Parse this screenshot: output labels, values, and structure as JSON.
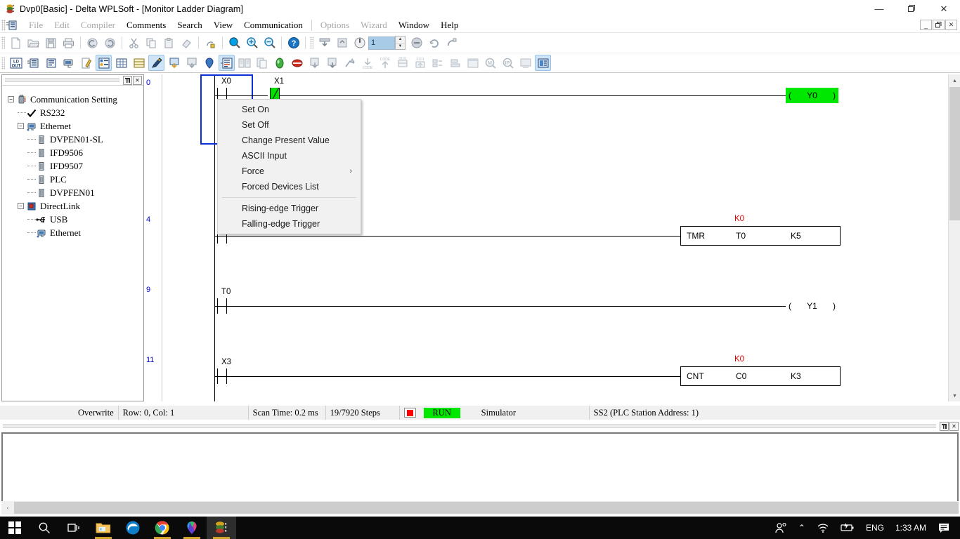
{
  "window": {
    "title": "Dvp0[Basic] - Delta WPLSoft - [Monitor Ladder Diagram]",
    "app_icon": "wplsoft-icon",
    "minimize": "—",
    "maximize": "❐",
    "close": "✕",
    "mdi_minimize": "_",
    "mdi_restore": "❐",
    "mdi_close": "✕"
  },
  "menubar": {
    "items": [
      {
        "label": "File",
        "disabled": true
      },
      {
        "label": "Edit",
        "disabled": true
      },
      {
        "label": "Compiler",
        "disabled": true
      },
      {
        "label": "Comments",
        "disabled": false
      },
      {
        "label": "Search",
        "disabled": false
      },
      {
        "label": "View",
        "disabled": false
      },
      {
        "label": "Communication",
        "disabled": false
      },
      {
        "label": "Options",
        "disabled": true
      },
      {
        "label": "Wizard",
        "disabled": true
      },
      {
        "label": "Window",
        "disabled": false
      },
      {
        "label": "Help",
        "disabled": false
      }
    ]
  },
  "toolbar_main": {
    "spin_value": "1",
    "buttons": [
      "new-file-icon",
      "open-file-icon",
      "save-icon",
      "print-icon",
      "undo-icon",
      "redo-icon",
      "cut-icon",
      "copy-icon",
      "paste-icon",
      "erase-icon",
      "ladder-instruction-toggle-icon",
      "zoom-icon",
      "zoom-in-icon",
      "zoom-out-icon",
      "help-icon",
      "download-plc-icon",
      "upload-plc-icon",
      "run-stop-icon",
      "plc-station-stepper",
      "stop-plc-icon",
      "monitor-refresh-icon",
      "program-monitor-icon"
    ]
  },
  "toolbar_ladder": {
    "buttons": [
      "ld-out-icon",
      "ladder-view-icon",
      "instruction-view-icon",
      "device-monitor-icon",
      "comment-edit-icon",
      "contact-list-icon",
      "grid-icon",
      "register-table-icon",
      "highlight-pen-icon",
      "insert-row-icon",
      "delete-row-icon",
      "balloon-comment-icon",
      "monitor-mode-icon",
      "compare-icon",
      "copy-program-icon",
      "run-green-icon",
      "stop-red-icon",
      "write-plc-icon",
      "read-plc-icon",
      "disconnect-icon",
      "code-down-icon",
      "code-up-icon",
      "code-table-icon",
      "bit-table-icon",
      "sort-icon",
      "align-icon",
      "window-icon",
      "find-device-icon",
      "find-instruction-icon",
      "save-image-icon",
      "simulator-icon"
    ],
    "active": [
      "contact-list-icon",
      "highlight-pen-icon",
      "monitor-mode-icon",
      "simulator-icon"
    ]
  },
  "left_dock": {
    "pin_label": "➤",
    "close_label": "✕",
    "tree": [
      {
        "label": "Communication Setting",
        "icon": "comm-setting-icon",
        "level": 0,
        "expander": "-"
      },
      {
        "label": "RS232",
        "icon": "check-icon",
        "level": 1,
        "expander": ""
      },
      {
        "label": "Ethernet",
        "icon": "ethernet-icon",
        "level": 1,
        "expander": "-"
      },
      {
        "label": "DVPEN01-SL",
        "icon": "module-icon",
        "level": 2,
        "expander": ""
      },
      {
        "label": "IFD9506",
        "icon": "module-icon",
        "level": 2,
        "expander": ""
      },
      {
        "label": "IFD9507",
        "icon": "module-icon",
        "level": 2,
        "expander": ""
      },
      {
        "label": "PLC",
        "icon": "module-icon",
        "level": 2,
        "expander": ""
      },
      {
        "label": "DVPFEN01",
        "icon": "module-icon",
        "level": 2,
        "expander": ""
      },
      {
        "label": "DirectLink",
        "icon": "directlink-icon",
        "level": 1,
        "expander": "-"
      },
      {
        "label": "USB",
        "icon": "usb-icon",
        "level": 2,
        "expander": ""
      },
      {
        "label": "Ethernet",
        "icon": "ethernet-icon",
        "level": 2,
        "expander": ""
      }
    ]
  },
  "ladder": {
    "rung_numbers": [
      "0",
      "4",
      "9",
      "11"
    ],
    "rungs": [
      {
        "number": "0",
        "contacts": [
          {
            "device": "X0",
            "type": "NO",
            "state": "off",
            "selected": true
          },
          {
            "device": "X1",
            "type": "NC",
            "state": "on",
            "selected": false
          }
        ],
        "coil": {
          "device": "Y0",
          "state": "on"
        }
      },
      {
        "number": "4",
        "contacts": [
          {
            "device": "",
            "type": "NO",
            "state": "off",
            "selected": false
          }
        ],
        "instruction": {
          "name": "TMR",
          "operand1": "T0",
          "operand2": "K5",
          "present_value": "K0"
        }
      },
      {
        "number": "9",
        "contacts": [
          {
            "device": "T0",
            "type": "NO",
            "state": "off",
            "selected": false
          }
        ],
        "coil": {
          "device": "Y1",
          "state": "off"
        }
      },
      {
        "number": "11",
        "contacts": [
          {
            "device": "X3",
            "type": "NO",
            "state": "off",
            "selected": false
          }
        ],
        "instruction": {
          "name": "CNT",
          "operand1": "C0",
          "operand2": "K3",
          "present_value": "K0"
        }
      }
    ]
  },
  "context_menu": {
    "items": [
      {
        "label": "Set On",
        "submenu": false
      },
      {
        "label": "Set Off",
        "submenu": false
      },
      {
        "label": "Change Present Value",
        "submenu": false
      },
      {
        "label": "ASCII Input",
        "submenu": false
      },
      {
        "label": "Force",
        "submenu": true,
        "arrow": "›"
      },
      {
        "label": "Forced Devices List",
        "submenu": false
      },
      {
        "separator": true
      },
      {
        "label": "Rising-edge Trigger",
        "submenu": false
      },
      {
        "label": "Falling-edge Trigger",
        "submenu": false
      }
    ]
  },
  "statusbar": {
    "mode": "Overwrite",
    "position": "Row: 0, Col: 1",
    "scan_time": "Scan Time: 0.2 ms",
    "steps": "19/7920 Steps",
    "run_label": "RUN",
    "connection": "Simulator",
    "plc_model": "SS2 (PLC Station Address: 1)"
  },
  "output_pane": {
    "content": "",
    "scroll_left": "‹"
  },
  "taskbar": {
    "items": [
      {
        "name": "start-button",
        "icon": "windows-logo-icon",
        "active": false
      },
      {
        "name": "search-button",
        "icon": "search-icon",
        "active": false
      },
      {
        "name": "task-view-button",
        "icon": "task-view-icon",
        "active": false
      },
      {
        "name": "file-explorer",
        "icon": "folder-icon",
        "active": false,
        "running": true
      },
      {
        "name": "microsoft-edge",
        "icon": "edge-icon",
        "active": false,
        "running": false
      },
      {
        "name": "google-chrome",
        "icon": "chrome-icon",
        "active": false,
        "running": true
      },
      {
        "name": "maps-app",
        "icon": "maps-pin-icon",
        "active": false,
        "running": true
      },
      {
        "name": "wplsoft-app",
        "icon": "wplsoft-icon",
        "active": true,
        "running": true
      }
    ],
    "tray": {
      "people_icon": "people-icon",
      "chevron_icon": "⌃",
      "network_icon": "wifi-icon",
      "battery_icon": "battery-icon",
      "language": "ENG",
      "time": "1:33 AM",
      "notifications_icon": "notification-icon"
    }
  },
  "colors": {
    "energized_green": "#00e800",
    "present_value_red": "#e00000",
    "rung_number_blue": "#0000cc",
    "selection_blue": "#0a2fd6",
    "taskbar_black": "#0a0a0a"
  }
}
